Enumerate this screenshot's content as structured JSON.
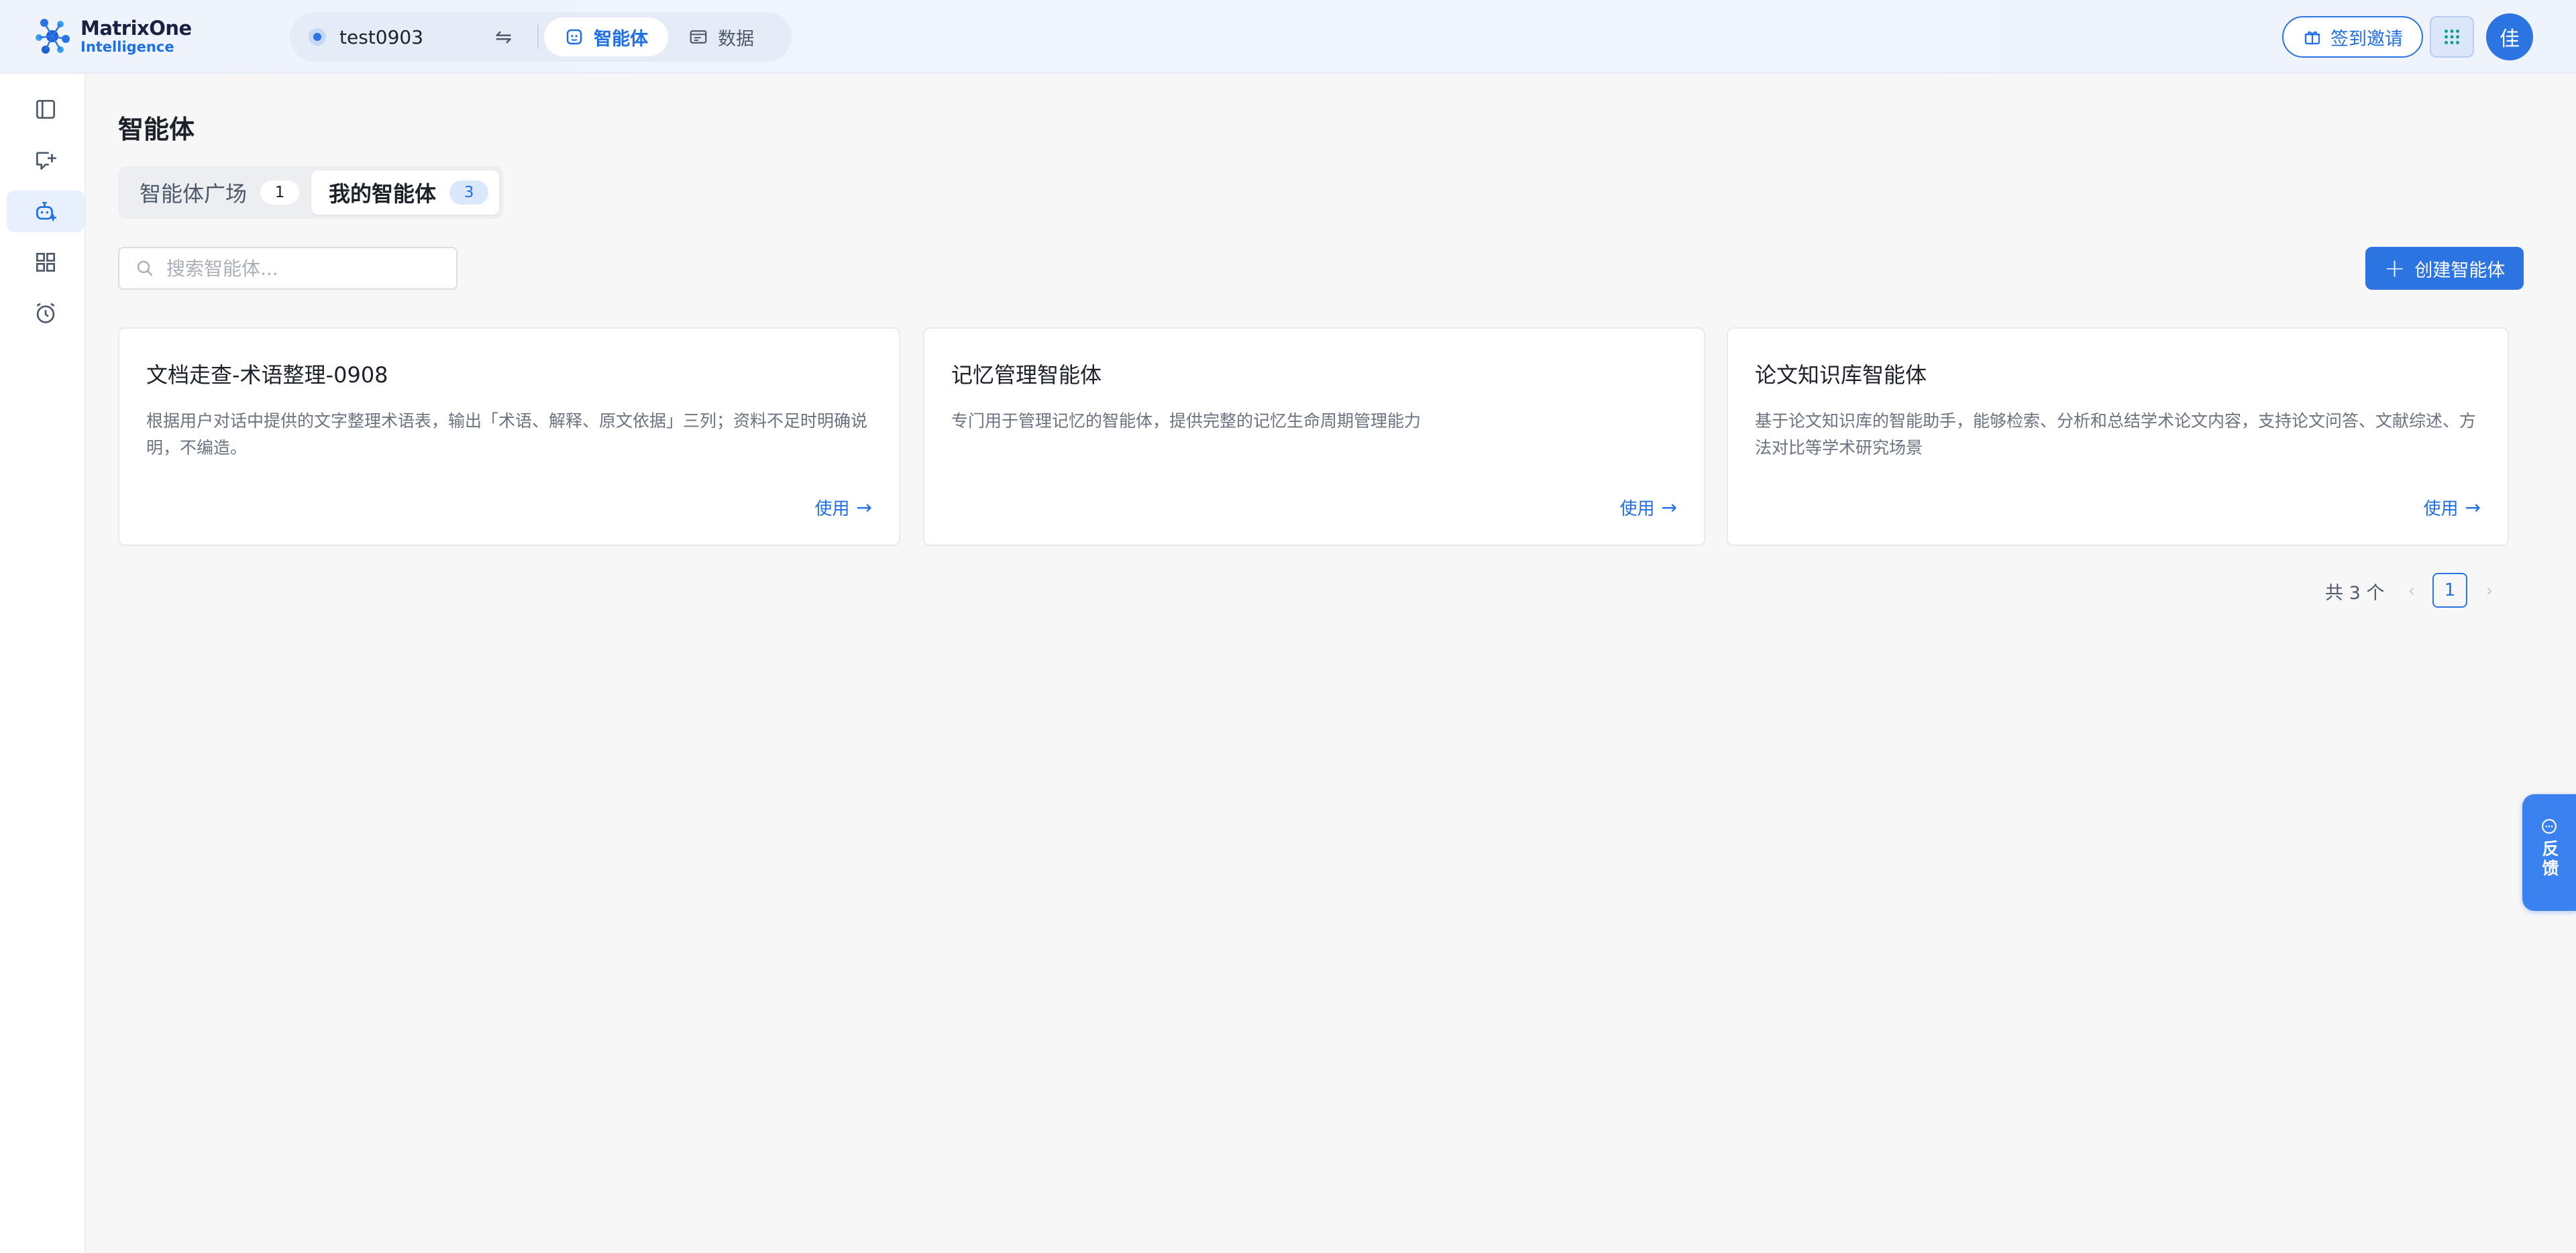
{
  "brand": {
    "name": "MatrixOne",
    "sub": "Intelligence"
  },
  "header": {
    "workspace_name": "test0903",
    "nav": [
      {
        "label": "智能体",
        "icon": "agent-icon",
        "active": true
      },
      {
        "label": "数据",
        "icon": "data-icon",
        "active": false
      }
    ],
    "invite_label": "签到邀请",
    "avatar_text": "佳"
  },
  "sidebar": {
    "items": [
      {
        "icon": "sidebar-toggle-icon",
        "active": false
      },
      {
        "icon": "new-chat-icon",
        "active": false
      },
      {
        "icon": "agent-icon",
        "active": true
      },
      {
        "icon": "apps-grid-icon",
        "active": false
      },
      {
        "icon": "alarm-clock-icon",
        "active": false
      }
    ]
  },
  "main": {
    "title": "智能体",
    "tabs": [
      {
        "label": "智能体广场",
        "count": "1",
        "active": false
      },
      {
        "label": "我的智能体",
        "count": "3",
        "active": true
      }
    ],
    "search_placeholder": "搜索智能体...",
    "create_label": "创建智能体",
    "cards": [
      {
        "title": "文档走查-术语整理-0908",
        "desc": "根据用户对话中提供的文字整理术语表，输出「术语、解释、原文依据」三列；资料不足时明确说明，不编造。",
        "use_label": "使用"
      },
      {
        "title": "记忆管理智能体",
        "desc": "专门用于管理记忆的智能体，提供完整的记忆生命周期管理能力",
        "use_label": "使用"
      },
      {
        "title": "论文知识库智能体",
        "desc": "基于论文知识库的智能助手，能够检索、分析和总结学术论文内容，支持论文问答、文献综述、方法对比等学术研究场景",
        "use_label": "使用"
      }
    ],
    "pagination": {
      "total_text": "共 3 个",
      "current_page": "1"
    }
  },
  "feedback": {
    "label": "反馈"
  },
  "colors": {
    "accent": "#2b74e2",
    "text": "#1d2129",
    "muted": "#6b7280",
    "bg": "#f7f7f8"
  }
}
